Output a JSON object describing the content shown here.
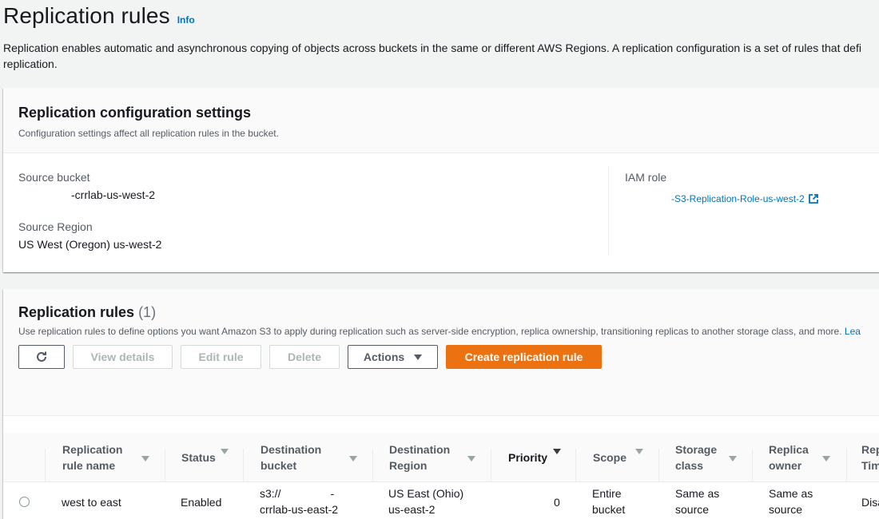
{
  "page": {
    "title": "Replication rules",
    "info": "Info",
    "description": "Replication enables automatic and asynchronous copying of objects across buckets in the same or different AWS Regions. A replication configuration is a set of rules that defi",
    "description_line2": "replication."
  },
  "config": {
    "title": "Replication configuration settings",
    "subtitle": "Configuration settings affect all replication rules in the bucket.",
    "source_bucket_label": "Source bucket",
    "source_bucket_value": "-crrlab-us-west-2",
    "source_region_label": "Source Region",
    "source_region_value": "US West (Oregon) us-west-2",
    "iam_role_label": "IAM role",
    "iam_role_value": "-S3-Replication-Role-us-west-2"
  },
  "rules": {
    "title": "Replication rules",
    "count": "(1)",
    "description": "Use replication rules to define options you want Amazon S3 to apply during replication such as server-side encryption, replica ownership, transitioning replicas to another storage class, and more.",
    "learn_more": "Lea",
    "buttons": {
      "view_details": "View details",
      "edit_rule": "Edit rule",
      "delete": "Delete",
      "actions": "Actions",
      "create": "Create replication rule"
    },
    "columns": {
      "name_1": "Replication",
      "name_2": "rule name",
      "status": "Status",
      "dest_bucket_1": "Destination",
      "dest_bucket_2": "bucket",
      "dest_region_1": "Destination",
      "dest_region_2": "Region",
      "priority": "Priority",
      "scope": "Scope",
      "storage_1": "Storage",
      "storage_2": "class",
      "owner_1": "Replica",
      "owner_2": "owner",
      "rep_1": "Rep",
      "rep_2": "Tim"
    },
    "row": {
      "name": "west to east",
      "status": "Enabled",
      "dest_bucket_1": "s3://",
      "dest_bucket_dash": "-",
      "dest_bucket_2": "crrlab-us-east-2",
      "dest_region_1": "US East (Ohio)",
      "dest_region_2": "us-east-2",
      "priority": "0",
      "scope_1": "Entire",
      "scope_2": "bucket",
      "storage_1": "Same as",
      "storage_2": "source",
      "owner_1": "Same as",
      "owner_2": "source",
      "rep": "Disa"
    }
  },
  "colors": {
    "primary_button": "#ec7211",
    "link": "#0073bb"
  }
}
